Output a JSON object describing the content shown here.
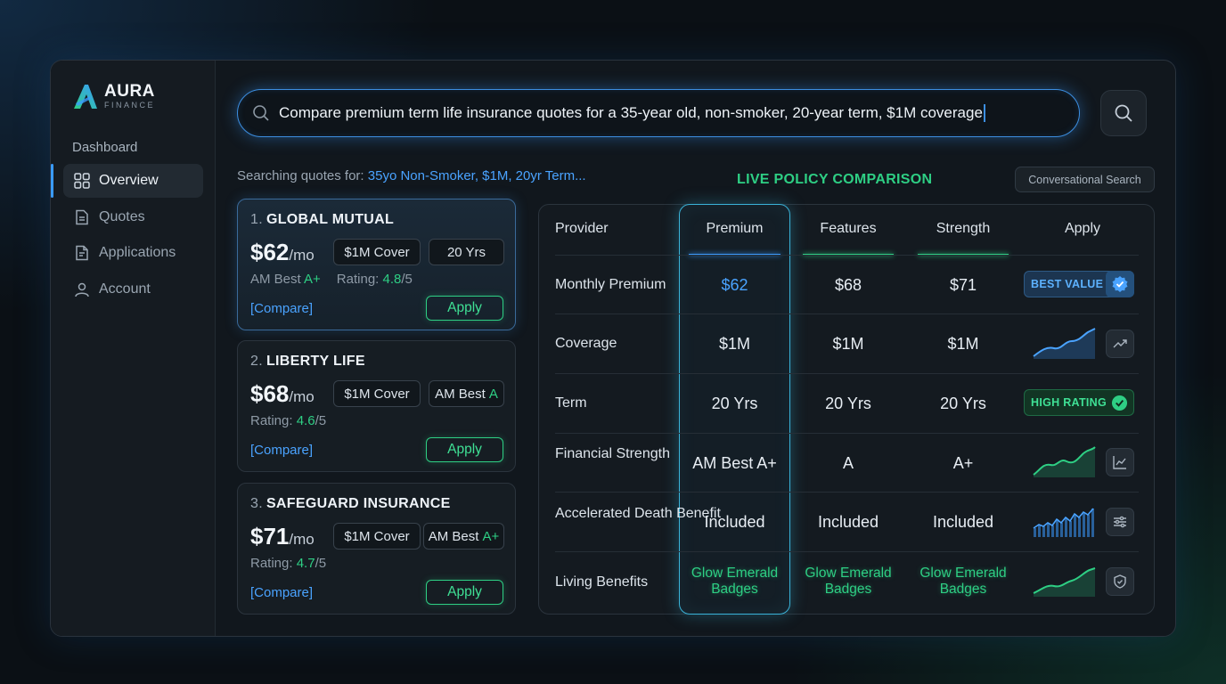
{
  "brand": {
    "name": "AURA",
    "sub": "FINANCE"
  },
  "sidebar": {
    "heading": "Dashboard",
    "items": [
      {
        "label": "Overview",
        "icon": "grid-icon",
        "active": true
      },
      {
        "label": "Quotes",
        "icon": "document-icon",
        "active": false
      },
      {
        "label": "Applications",
        "icon": "file-icon",
        "active": false
      },
      {
        "label": "Account",
        "icon": "user-icon",
        "active": false
      }
    ]
  },
  "search": {
    "query": "Compare premium term life insurance quotes for a 35-year old, non-smoker, 20-year term, $1M coverage",
    "button_icon": "search-icon"
  },
  "results": {
    "searching_prefix": "Searching quotes for:",
    "searching_terms": "35yo Non-Smoker, $1M, 20yr Term...",
    "live_title": "LIVE POLICY COMPARISON",
    "conversational_search": "Conversational Search"
  },
  "quotes": [
    {
      "num": "1.",
      "name": "GLOBAL MUTUAL",
      "price": "$62",
      "per": "/mo",
      "chip1": "$1M Cover",
      "chip2": "20 Yrs",
      "am_label": "AM Best",
      "am_value": "A+",
      "rating_label": "Rating:",
      "rating_value": "4.8",
      "rating_of": "/5",
      "compare": "[Compare]",
      "apply": "Apply"
    },
    {
      "num": "2.",
      "name": "LIBERTY LIFE",
      "price": "$68",
      "per": "/mo",
      "chip1": "$1M Cover",
      "chip2_label": "AM Best",
      "chip2_value": "A",
      "rating_label": "Rating:",
      "rating_value": "4.6",
      "rating_of": "/5",
      "compare": "[Compare]",
      "apply": "Apply"
    },
    {
      "num": "3.",
      "name": "SAFEGUARD INSURANCE",
      "price": "$71",
      "per": "/mo",
      "chip1": "$1M Cover",
      "chip2_label": "AM Best",
      "chip2_value": "A+",
      "rating_label": "Rating:",
      "rating_value": "4.7",
      "rating_of": "/5",
      "compare": "[Compare]",
      "apply": "Apply"
    }
  ],
  "table": {
    "headers": [
      "Provider",
      "Premium",
      "Features",
      "Strength",
      "Apply"
    ],
    "rows": [
      {
        "label": "Monthly Premium",
        "values": [
          "$62",
          "$68",
          "$71"
        ],
        "extra": "BEST VALUE",
        "icon": "verified-badge-icon"
      },
      {
        "label": "Coverage",
        "values": [
          "$1M",
          "$1M",
          "$1M"
        ],
        "icon": "trend-up-icon"
      },
      {
        "label": "Term",
        "values": [
          "20 Yrs",
          "20 Yrs",
          "20 Yrs"
        ],
        "extra": "HIGH RATING",
        "icon": "check-circle-icon"
      },
      {
        "label": "Financial Strength",
        "values": [
          "AM Best A+",
          "A",
          "A+"
        ],
        "icon": "line-chart-icon"
      },
      {
        "label": "Accelerated Death Benefit",
        "values": [
          "Included",
          "Included",
          "Included"
        ],
        "icon": "sliders-icon"
      },
      {
        "label": "Living Benefits",
        "values": [
          "Glow Emerald Badges",
          "Glow Emerald Badges",
          "Glow Emerald Badges"
        ],
        "icon": "shield-icon"
      }
    ]
  },
  "colors": {
    "accent_blue": "#3a9bff",
    "accent_green": "#2ecf84",
    "premium_col": "#3ab3d8"
  }
}
